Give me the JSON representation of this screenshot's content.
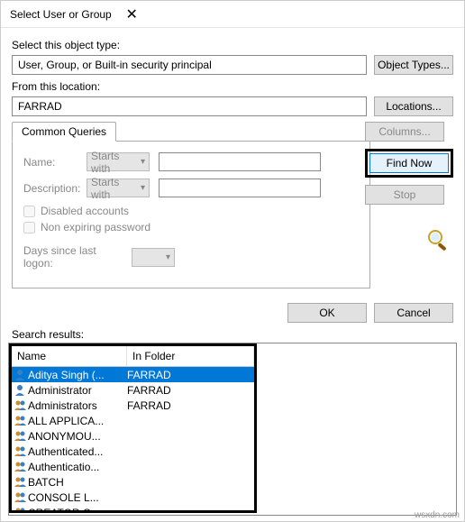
{
  "window": {
    "title": "Select User or Group"
  },
  "objectType": {
    "label": "Select this object type:",
    "value": "User, Group, or Built-in security principal",
    "button": "Object Types..."
  },
  "location": {
    "label": "From this location:",
    "value": "FARRAD",
    "button": "Locations..."
  },
  "tabs": {
    "common": "Common Queries"
  },
  "query": {
    "nameLabel": "Name:",
    "nameCombo": "Starts with",
    "descLabel": "Description:",
    "descCombo": "Starts with",
    "disabled": "Disabled accounts",
    "nonexpire": "Non expiring password",
    "daysLabel": "Days since last logon:"
  },
  "sideButtons": {
    "columns": "Columns...",
    "findNow": "Find Now",
    "stop": "Stop"
  },
  "dialogButtons": {
    "ok": "OK",
    "cancel": "Cancel"
  },
  "results": {
    "label": "Search results:",
    "columns": {
      "name": "Name",
      "folder": "In Folder"
    },
    "rows": [
      {
        "name": "Aditya Singh (...",
        "folder": "FARRAD",
        "type": "user"
      },
      {
        "name": "Administrator",
        "folder": "FARRAD",
        "type": "user"
      },
      {
        "name": "Administrators",
        "folder": "FARRAD",
        "type": "group"
      },
      {
        "name": "ALL APPLICA...",
        "folder": "",
        "type": "group"
      },
      {
        "name": "ANONYMOU...",
        "folder": "",
        "type": "group"
      },
      {
        "name": "Authenticated...",
        "folder": "",
        "type": "group"
      },
      {
        "name": "Authenticatio...",
        "folder": "",
        "type": "group"
      },
      {
        "name": "BATCH",
        "folder": "",
        "type": "group"
      },
      {
        "name": "CONSOLE L...",
        "folder": "",
        "type": "group"
      },
      {
        "name": "CREATOR G...",
        "folder": "",
        "type": "group"
      }
    ]
  },
  "watermark": "wsxdn.com"
}
